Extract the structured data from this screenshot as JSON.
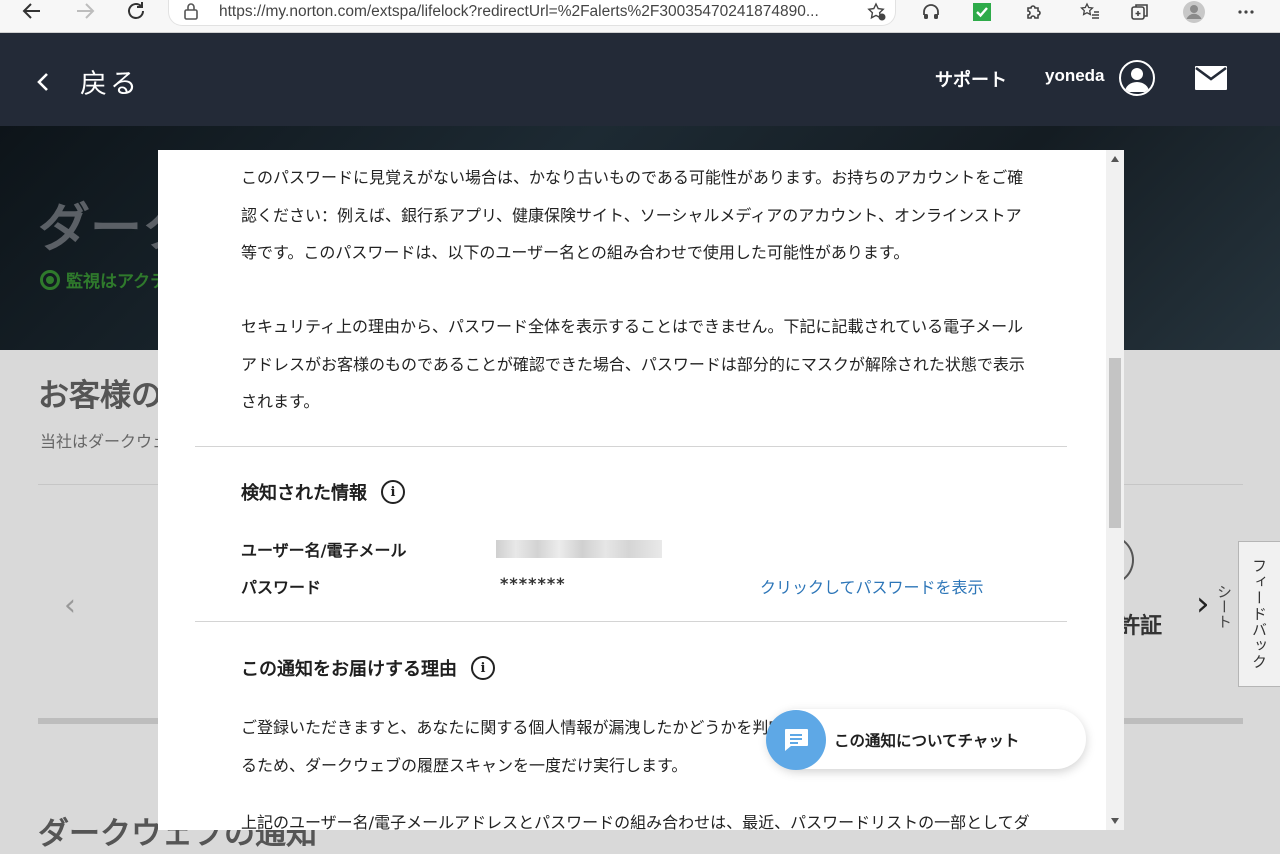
{
  "browser": {
    "url": "https://my.norton.com/extspa/lifelock?redirectUrl=%2Falerts%2F30035470241874890..."
  },
  "header": {
    "back_label": "戻る",
    "support_label": "サポート",
    "username": "yoneda"
  },
  "background": {
    "hero_title": "ダーク",
    "hero_status": "監視はアクテ",
    "heading": "お客様の",
    "subtext": "当社はダークウェ",
    "card_label": "許証",
    "card_vertical_text": "シート",
    "bottom_heading": "ダークウェブの通知",
    "feedback_label": "フィードバック"
  },
  "modal": {
    "intro_paragraph": "このパスワードに見覚えがない場合は、かなり古いものである可能性があります。お持ちのアカウントをご確認ください：例えば、銀行系アプリ、健康保険サイト、ソーシャルメディアのアカウント、オンラインストア等です。このパスワードは、以下のユーザー名との組み合わせで使用した可能性があります。",
    "security_paragraph": "セキュリティ上の理由から、パスワード全体を表示することはできません。下記に記載されている電子メールアドレスがお客様のものであることが確認できた場合、パスワードは部分的にマスクが解除された状態で表示されます。",
    "detected": {
      "title": "検知された情報",
      "username_label": "ユーザー名/電子メール",
      "password_label": "パスワード",
      "password_value": "*******",
      "show_password_link": "クリックしてパスワードを表示"
    },
    "reason": {
      "title": "この通知をお届けする理由",
      "paragraph1": "ご登録いただきますと、あなたに関する個人情報が漏洩したかどうかを判定するため、ダークウェブの履歴スキャンを一度だけ実行します。",
      "paragraph2": "上記のユーザー名/電子メールアドレスとパスワードの組み合わせは、最近、パスワードリストの一部としてダークウ"
    },
    "chat_label": "この通知についてチャット"
  }
}
